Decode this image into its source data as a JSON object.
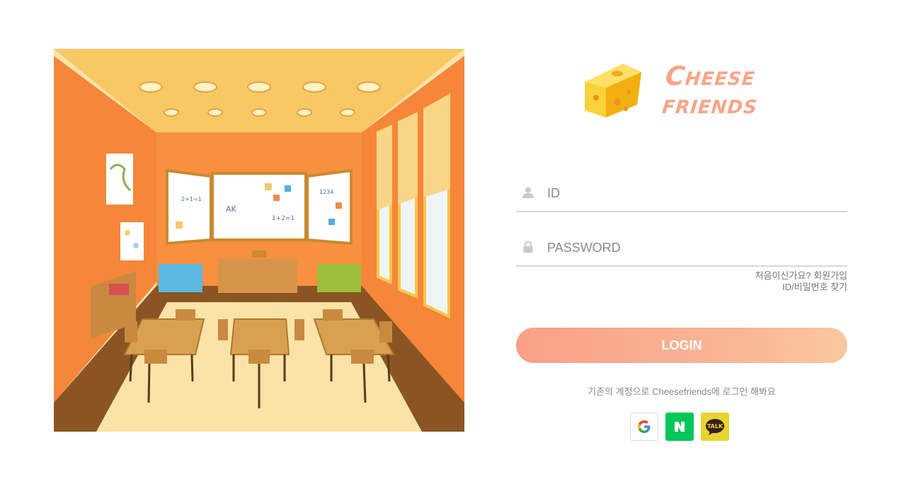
{
  "brand": {
    "line1": "Cheese",
    "line2": "friends",
    "color": "#f8a58a"
  },
  "login_form": {
    "id_placeholder": "ID",
    "password_placeholder": "PASSWORD",
    "signup_link": "처음이신가요? 회원가입",
    "find_link": "ID/비밀번호 찾기",
    "login_label": "LOGIN"
  },
  "social": {
    "caption": "기존의 계정으로 Cheesefriends에 로그인 해봐요",
    "providers": [
      {
        "name": "Google",
        "icon": "google-icon",
        "color": "#ffffff"
      },
      {
        "name": "Naver",
        "icon": "naver-icon",
        "color": "#03c75a"
      },
      {
        "name": "Kakao",
        "icon": "kakao-talk-icon",
        "color": "#e6d52f",
        "badge": "TALK"
      }
    ]
  },
  "colors": {
    "accent_start": "#f8a088",
    "accent_end": "#f9c8a0"
  }
}
